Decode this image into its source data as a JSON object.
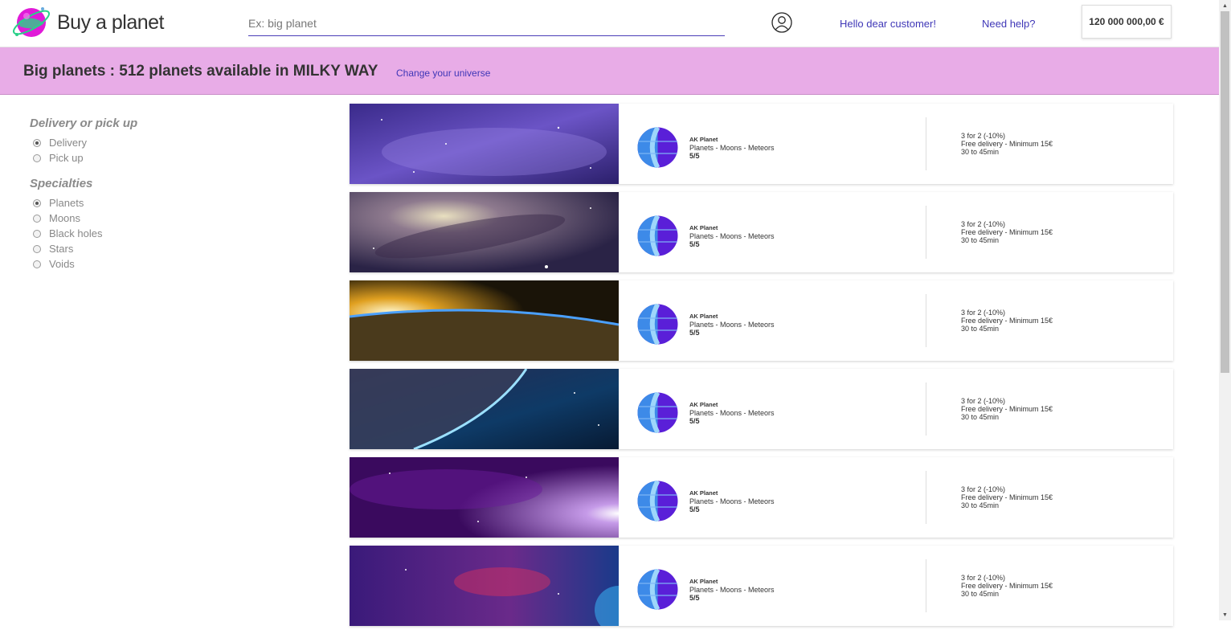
{
  "header": {
    "brand": "Buy a planet",
    "search_placeholder": "Ex: big planet",
    "hello_link": "Hello dear customer!",
    "help_link": "Need help?",
    "cart_amount": "120 000 000,00 €"
  },
  "banner": {
    "title": "Big planets : 512 planets available in MILKY WAY",
    "change_link": "Change your universe"
  },
  "filters": {
    "delivery": {
      "title": "Delivery or pick up",
      "options": [
        {
          "label": "Delivery",
          "checked": true
        },
        {
          "label": "Pick up",
          "checked": false
        }
      ]
    },
    "specialties": {
      "title": "Specialties",
      "options": [
        {
          "label": "Planets",
          "checked": true
        },
        {
          "label": "Moons",
          "checked": false
        },
        {
          "label": "Black holes",
          "checked": false
        },
        {
          "label": "Stars",
          "checked": false
        },
        {
          "label": "Voids",
          "checked": false
        }
      ]
    }
  },
  "listings": [
    {
      "name": "AK Planet",
      "categories": "Planets - Moons - Meteors",
      "rating": "5/5",
      "deal": "3 for 2 (-10%)",
      "delivery": "Free delivery - Minimum 15€",
      "time": "30 to 45min"
    },
    {
      "name": "AK Planet",
      "categories": "Planets - Moons - Meteors",
      "rating": "5/5",
      "deal": "3 for 2 (-10%)",
      "delivery": "Free delivery - Minimum 15€",
      "time": "30 to 45min"
    },
    {
      "name": "AK Planet",
      "categories": "Planets - Moons - Meteors",
      "rating": "5/5",
      "deal": "3 for 2 (-10%)",
      "delivery": "Free delivery - Minimum 15€",
      "time": "30 to 45min"
    },
    {
      "name": "AK Planet",
      "categories": "Planets - Moons - Meteors",
      "rating": "5/5",
      "deal": "3 for 2 (-10%)",
      "delivery": "Free delivery - Minimum 15€",
      "time": "30 to 45min"
    },
    {
      "name": "AK Planet",
      "categories": "Planets - Moons - Meteors",
      "rating": "5/5",
      "deal": "3 for 2 (-10%)",
      "delivery": "Free delivery - Minimum 15€",
      "time": "30 to 45min"
    },
    {
      "name": "AK Planet",
      "categories": "Planets - Moons - Meteors",
      "rating": "5/5",
      "deal": "3 for 2 (-10%)",
      "delivery": "Free delivery - Minimum 15€",
      "time": "30 to 45min"
    }
  ],
  "colors": {
    "banner_bg": "#e8ace7",
    "link": "#3f37b7",
    "accent": "#4a3db8"
  }
}
